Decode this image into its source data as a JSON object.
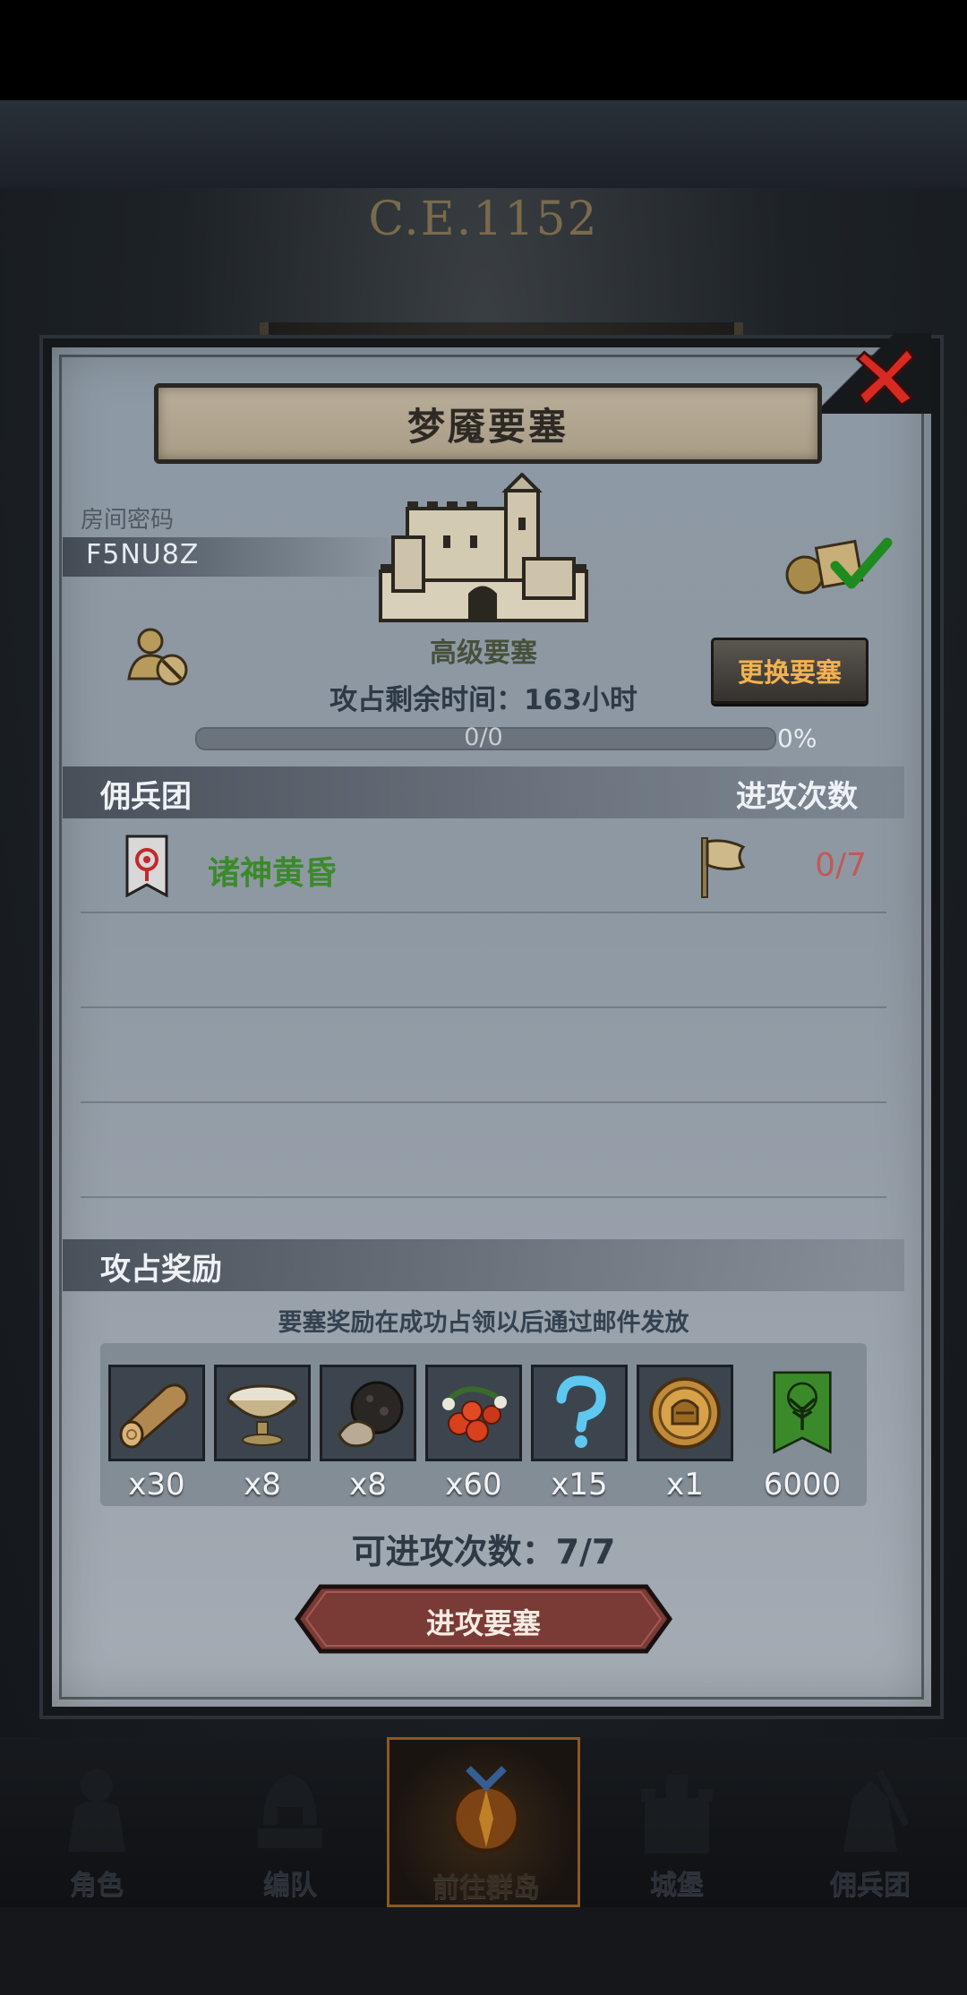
{
  "header": {
    "era": "C.E.1152"
  },
  "dialog": {
    "title": "梦魇要塞",
    "room_label": "房间密码",
    "room_code": "F5NU8Z",
    "fortress_type": "高级要塞",
    "change_button": "更换要塞",
    "time_left": "攻占剩余时间：163小时",
    "progress": {
      "label": "0/0",
      "percent_text": "0%",
      "fraction": 0.0
    },
    "mercenary_header": "佣兵团",
    "attack_header": "进攻次数",
    "guilds": [
      {
        "name": "诸神黄昏",
        "attacks": "0/7"
      }
    ],
    "reward_header": "攻占奖励",
    "reward_note": "要塞奖励在成功占领以后通过邮件发放",
    "rewards": [
      {
        "icon": "wood-log-icon",
        "count": "x30"
      },
      {
        "icon": "milk-bowl-icon",
        "count": "x8"
      },
      {
        "icon": "truffle-icon",
        "count": "x8"
      },
      {
        "icon": "berries-icon",
        "count": "x60"
      },
      {
        "icon": "question-mark-icon",
        "count": "x15"
      },
      {
        "icon": "knight-coin-icon",
        "count": "x1"
      },
      {
        "icon": "tree-banner-icon",
        "count": "6000"
      }
    ],
    "attempts": "可进攻次数：7/7",
    "attack_button": "进攻要塞"
  },
  "nav": [
    {
      "label": "角色",
      "icon": "knight-icon"
    },
    {
      "label": "编队",
      "icon": "helmet-icon"
    },
    {
      "label": "前往群岛",
      "icon": "compass-icon",
      "active": true
    },
    {
      "label": "城堡",
      "icon": "castle-icon"
    },
    {
      "label": "佣兵团",
      "icon": "mercenary-icon"
    }
  ],
  "colors": {
    "panel": "#8d99a4",
    "guild_name": "#3b8a2a",
    "attack_count": "#c05a58",
    "change_button_text": "#f2b24e",
    "close_red": "#d62a22"
  }
}
